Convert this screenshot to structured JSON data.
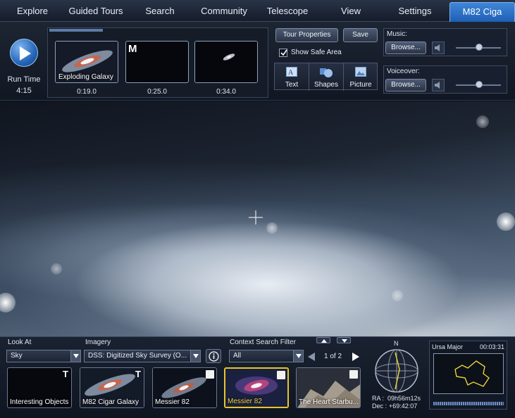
{
  "nav": {
    "tabs": [
      "Explore",
      "Guided Tours",
      "Search",
      "Community",
      "Telescope",
      "View",
      "Settings",
      "M82 Ciga"
    ]
  },
  "tour": {
    "run_time_label": "Run Time",
    "run_time_value": "4:15",
    "slides": [
      {
        "caption": "Exploding Galaxy",
        "time": "0:19.0"
      },
      {
        "caption": "M",
        "time": "0:25.0"
      },
      {
        "caption": "",
        "time": "0:34.0"
      }
    ],
    "tour_properties_label": "Tour Properties",
    "save_label": "Save",
    "show_safe_area_label": "Show Safe Area",
    "show_safe_area_checked": true,
    "tools": {
      "text": "Text",
      "shapes": "Shapes",
      "picture": "Picture"
    },
    "music": {
      "title": "Music:",
      "browse": "Browse..."
    },
    "voiceover": {
      "title": "Voiceover:",
      "browse": "Browse..."
    }
  },
  "explorer": {
    "look_at_label": "Look At",
    "look_at_value": "Sky",
    "imagery_label": "Imagery",
    "imagery_value": "DSS: Digitized Sky Survey (O...",
    "context_label": "Context Search Filter",
    "context_value": "All",
    "page_indicator": "1 of 2",
    "items": [
      {
        "label": "Interesting Objects",
        "selected": false
      },
      {
        "label": "M82 Cigar Galaxy",
        "selected": false
      },
      {
        "label": "Messier 82",
        "selected": false
      },
      {
        "label": "Messier 82",
        "selected": true
      },
      {
        "label": "The Heart Starbu...",
        "selected": false
      }
    ],
    "compass_north": "N",
    "ra_label": "RA :",
    "ra_value": "09h56m12s",
    "dec_label": "Dec :",
    "dec_value": "+69:42:07",
    "constellation": "Ursa Major",
    "constellation_time": "00:03:31"
  },
  "colors": {
    "accent": "#2f75cc",
    "selection": "#e7c52b"
  }
}
